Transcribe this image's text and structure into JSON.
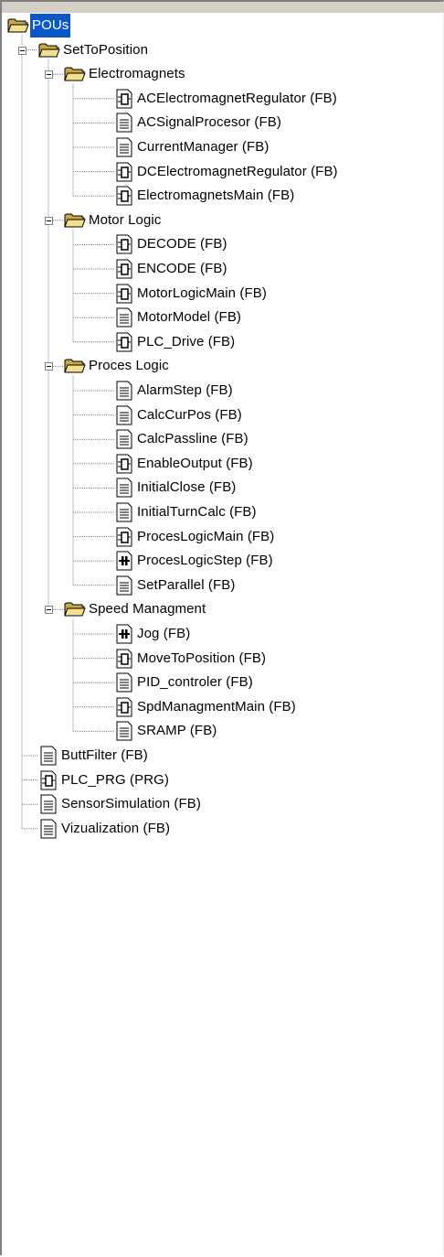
{
  "tree": {
    "root": {
      "label": "POUs",
      "icon": "folder-open-icon"
    },
    "folders": [
      {
        "label": "SetToPosition",
        "subfolders": [
          {
            "label": "Electromagnets",
            "items": [
              {
                "label": "ACElectromagnetRegulator (FB)",
                "icon": "fbd-pou-icon"
              },
              {
                "label": "ACSignalProcesor (FB)",
                "icon": "st-pou-icon"
              },
              {
                "label": "CurrentManager (FB)",
                "icon": "st-pou-icon"
              },
              {
                "label": "DCElectromagnetRegulator (FB)",
                "icon": "fbd-pou-icon"
              },
              {
                "label": "ElectromagnetsMain (FB)",
                "icon": "fbd-pou-icon"
              }
            ]
          },
          {
            "label": "Motor Logic",
            "items": [
              {
                "label": "DECODE (FB)",
                "icon": "fbd-pou-icon"
              },
              {
                "label": "ENCODE (FB)",
                "icon": "fbd-pou-icon"
              },
              {
                "label": "MotorLogicMain (FB)",
                "icon": "fbd-pou-icon"
              },
              {
                "label": "MotorModel (FB)",
                "icon": "st-pou-icon"
              },
              {
                "label": "PLC_Drive (FB)",
                "icon": "fbd-pou-icon"
              }
            ]
          },
          {
            "label": "Proces Logic",
            "items": [
              {
                "label": "AlarmStep (FB)",
                "icon": "st-pou-icon"
              },
              {
                "label": "CalcCurPos (FB)",
                "icon": "st-pou-icon"
              },
              {
                "label": "CalcPassline (FB)",
                "icon": "st-pou-icon"
              },
              {
                "label": "EnableOutput (FB)",
                "icon": "fbd-pou-icon"
              },
              {
                "label": "InitialClose (FB)",
                "icon": "st-pou-icon"
              },
              {
                "label": "InitialTurnCalc (FB)",
                "icon": "st-pou-icon"
              },
              {
                "label": "ProcesLogicMain (FB)",
                "icon": "fbd-pou-icon"
              },
              {
                "label": "ProcesLogicStep (FB)",
                "icon": "ld-pou-icon"
              },
              {
                "label": "SetParallel (FB)",
                "icon": "st-pou-icon"
              }
            ]
          },
          {
            "label": "Speed Managment",
            "items": [
              {
                "label": "Jog (FB)",
                "icon": "ld-pou-icon"
              },
              {
                "label": "MoveToPosition (FB)",
                "icon": "fbd-pou-icon"
              },
              {
                "label": "PID_controler (FB)",
                "icon": "st-pou-icon"
              },
              {
                "label": "SpdManagmentMain (FB)",
                "icon": "fbd-pou-icon"
              },
              {
                "label": "SRAMP (FB)",
                "icon": "st-pou-icon"
              }
            ]
          }
        ]
      }
    ],
    "top_items": [
      {
        "label": "ButtFilter (FB)",
        "icon": "st-pou-icon"
      },
      {
        "label": "PLC_PRG (PRG)",
        "icon": "fbd-pou-icon"
      },
      {
        "label": "SensorSimulation (FB)",
        "icon": "st-pou-icon"
      },
      {
        "label": "Vizualization (FB)",
        "icon": "st-pou-icon"
      }
    ]
  }
}
